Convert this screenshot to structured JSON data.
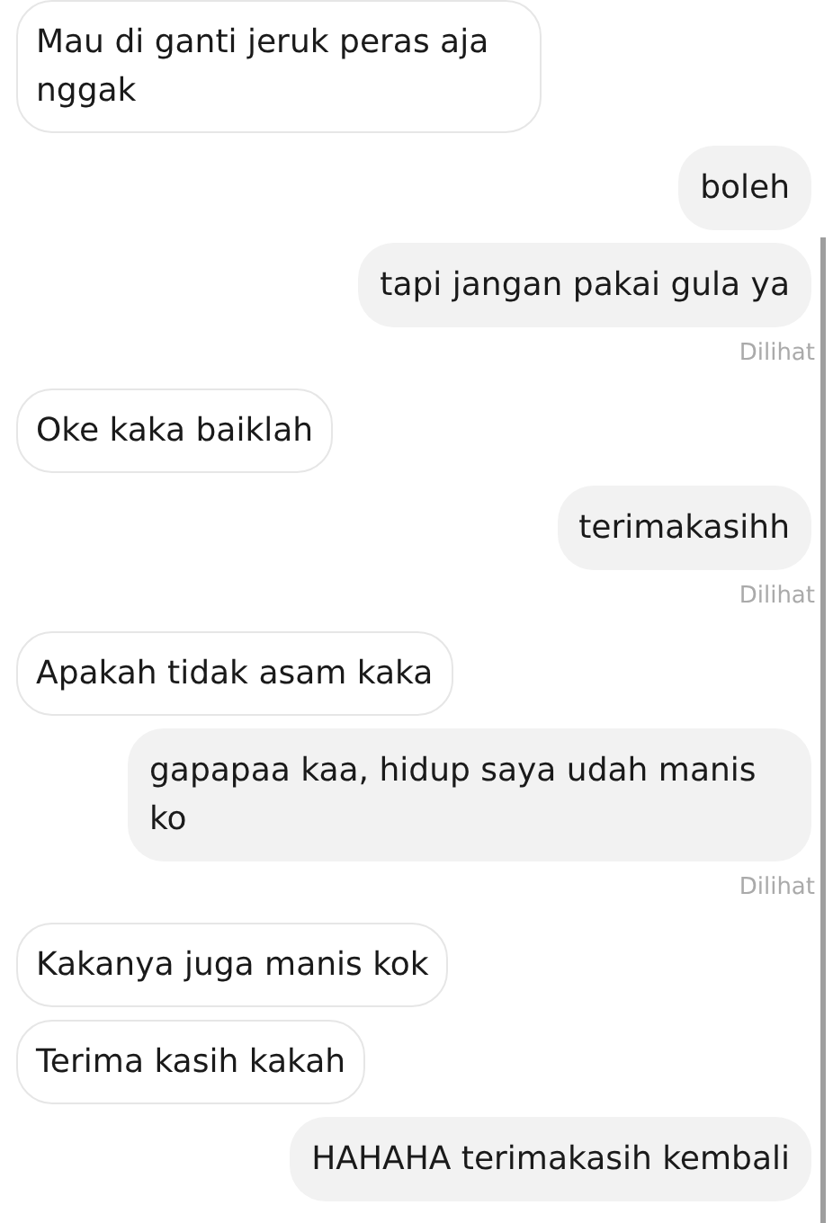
{
  "messages": [
    {
      "kind": "incoming",
      "text": "Mau di ganti jeruk peras aja nggak"
    },
    {
      "kind": "outgoing",
      "text": "boleh"
    },
    {
      "kind": "outgoing",
      "text": "tapi jangan pakai gula ya"
    },
    {
      "kind": "receipt",
      "text": "Dilihat"
    },
    {
      "kind": "incoming",
      "text": "Oke kaka baiklah"
    },
    {
      "kind": "outgoing",
      "text": "terimakasihh"
    },
    {
      "kind": "receipt",
      "text": "Dilihat"
    },
    {
      "kind": "incoming",
      "text": "Apakah tidak asam kaka"
    },
    {
      "kind": "outgoing",
      "text": "gapapaa kaa, hidup saya udah manis ko"
    },
    {
      "kind": "receipt",
      "text": "Dilihat"
    },
    {
      "kind": "incoming",
      "text": "Kakanya juga manis kok"
    },
    {
      "kind": "incoming",
      "text": "Terima kasih kakah"
    },
    {
      "kind": "outgoing",
      "text": "HAHAHA terimakasih kembali"
    }
  ]
}
